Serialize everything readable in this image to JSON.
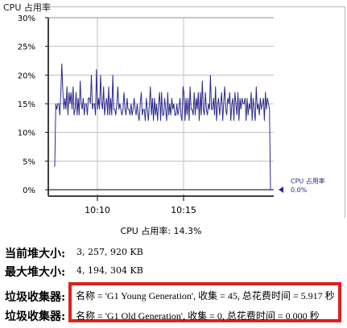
{
  "panel": {
    "title": "CPU 占用率"
  },
  "chart_data": {
    "type": "line",
    "title": "CPU 占用率",
    "ylim": [
      0,
      30
    ],
    "yticks": [
      "0%",
      "5%",
      "10%",
      "15%",
      "20%",
      "25%",
      "30%"
    ],
    "xticks": [
      "10:10",
      "10:15"
    ],
    "grid": true,
    "series": [
      {
        "name": "CPU 占用率",
        "values": [
          4,
          15,
          14,
          15,
          15,
          13,
          17,
          22,
          17,
          14,
          16,
          14,
          18,
          13,
          17,
          15,
          17,
          14,
          18,
          13,
          14,
          17,
          13,
          16,
          13,
          19,
          15,
          14,
          16,
          13,
          15,
          15,
          13,
          16,
          16,
          15,
          20,
          14,
          15,
          15,
          13,
          21,
          14,
          16,
          14,
          20,
          15,
          14,
          18,
          13,
          15,
          16,
          13,
          18,
          13,
          16,
          13,
          20,
          14,
          14,
          13,
          15,
          18,
          14,
          15,
          14,
          13,
          14,
          17,
          14,
          13,
          16,
          14,
          14,
          13,
          15,
          13,
          14,
          16,
          14,
          13,
          15,
          13,
          12,
          15,
          17,
          13,
          14,
          14,
          12,
          16,
          14,
          12,
          15,
          18,
          13,
          16,
          12,
          16,
          13,
          15,
          12,
          15,
          17,
          12,
          17,
          13,
          13,
          16,
          14,
          12,
          17,
          13,
          15,
          13,
          16,
          14,
          15,
          13,
          13,
          15,
          13,
          14,
          16,
          13,
          12,
          18,
          17,
          12,
          16,
          13,
          16,
          12,
          18,
          14,
          14,
          13,
          17,
          13,
          16,
          14,
          17,
          12,
          17,
          13,
          19,
          14,
          13,
          17,
          14,
          13,
          15,
          14,
          20,
          14,
          14,
          16,
          13,
          18,
          12,
          15,
          16,
          13,
          15,
          17,
          12,
          15,
          18,
          14,
          13,
          16,
          15,
          17,
          12,
          15,
          16,
          12,
          17,
          15,
          13,
          17,
          12,
          16,
          14,
          16,
          15,
          15,
          16,
          12,
          16,
          13,
          15,
          14,
          17,
          12,
          16,
          14,
          12,
          18,
          14,
          15,
          13,
          16,
          14,
          15,
          16,
          12,
          17,
          14,
          16,
          15,
          14,
          0
        ]
      }
    ],
    "legend": {
      "label": "CPU 占用率",
      "value": "0.0%",
      "placement": "right"
    },
    "caption": "CPU 占用率: 14.3%",
    "colors": {
      "line": "#2b2b8c",
      "grid": "#c0c0c0",
      "legend_text": "#2b2b8c"
    }
  },
  "heap": {
    "current_label": "当前堆大小:",
    "current_value": "3, 257, 920 KB",
    "max_label": "最大堆大小:",
    "max_value": "4, 194, 304 KB"
  },
  "gc": {
    "label": "垃圾收集器:",
    "entries": [
      "名称 = 'G1 Young Generation', 收集 = 45, 总花费时间 = 5.917 秒",
      "名称 = 'G1 Old Generation', 收集 = 0, 总花费时间 = 0.000 秒"
    ],
    "highlight_color": "#e0201c"
  }
}
